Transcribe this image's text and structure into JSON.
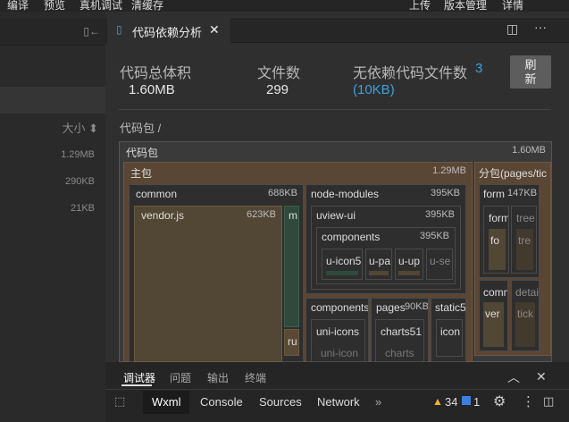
{
  "menu": [
    "编译",
    "预览",
    "真机调试",
    "清缓存",
    "上传",
    "版本管理",
    "详情"
  ],
  "sidebar": {
    "sort_label": "大小",
    "sizes": [
      "1.29MB",
      "290KB",
      "21KB"
    ]
  },
  "tab": {
    "title": "代码依赖分析"
  },
  "stats": {
    "total_label": "代码总体积",
    "total_value": "1.60MB",
    "files_label": "文件数",
    "files_value": "299",
    "nodep_label": "无依赖代码文件数",
    "nodep_count": "3",
    "nodep_size": "(10KB)"
  },
  "refresh_label": "刷新",
  "breadcrumb": "代码包 /",
  "treemap": {
    "root": {
      "name": "代码包",
      "size": "1.60MB"
    },
    "main_pkg": {
      "name": "主包",
      "size": "1.29MB"
    },
    "common": {
      "name": "common",
      "size": "688KB"
    },
    "vendor": {
      "name": "vendor.js",
      "size": "623KB"
    },
    "m": "m",
    "ru": "ru",
    "node_modules": {
      "name": "node-modules",
      "size": "395KB"
    },
    "uview": {
      "name": "uview-ui",
      "size": "395KB"
    },
    "components_inner": {
      "name": "components",
      "size": "395KB"
    },
    "u_icon": "u-icon5",
    "u_pa": "u-pa",
    "u_up": "u-up",
    "u_se": "u-se",
    "components": {
      "name": "components"
    },
    "uni_icons": "uni-icons",
    "uni_icon2": "uni-icon",
    "pages": {
      "name": "pages",
      "size": "90KB"
    },
    "charts": "charts51",
    "charts2": "charts",
    "static": "static5",
    "icon": "icon",
    "subpkg": {
      "name": "分包(pages/tic"
    },
    "form": {
      "name": "form",
      "size": "147KB"
    },
    "form_in": "form",
    "tree": "tree",
    "fo": "fo",
    "tre": "tre",
    "comm": "comm",
    "detail": "detai",
    "ver": "ver",
    "tick": "tick"
  },
  "panel_tabs": [
    "调试器",
    "问题",
    "输出",
    "终端"
  ],
  "devtools_tabs": [
    "Wxml",
    "Console",
    "Sources",
    "Network"
  ],
  "warnings": "34",
  "errors": "1",
  "colors": {
    "accent": "#3d9fe0",
    "vendor": "#524634",
    "teal": "#2f4a3c"
  }
}
